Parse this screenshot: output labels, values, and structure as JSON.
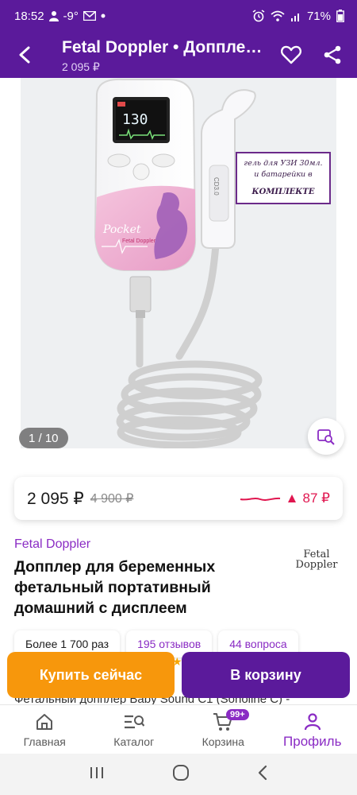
{
  "status_bar": {
    "time": "18:52",
    "temperature": "-9°",
    "battery": "71%"
  },
  "header": {
    "title": "Fetal Doppler • Допплер для беременных фетальный",
    "price": "2 095 ₽"
  },
  "gallery": {
    "counter": "1 / 10",
    "device_screen_value": "130",
    "device_brand": "Pocket",
    "device_subbrand": "Fetal Doppler",
    "probe_label": "CD3.0",
    "sticker_lines": [
      "гель для УЗИ 30мл.",
      "и батарейки в",
      "КОМПЛЕКТЕ"
    ]
  },
  "price": {
    "current": "2 095 ₽",
    "old": "4 900 ₽",
    "trend_change": "87 ₽"
  },
  "product": {
    "brand": "Fetal Doppler",
    "title": "Допплер для беременных фетальный портативный домашний с дисплеем",
    "logo_line1": "Fetal",
    "logo_line2": "Doppler",
    "description_preview": "Фетальный допплер Baby Sound C1 (Sonoline C) - "
  },
  "chips": {
    "sold": "Более 1 700 раз",
    "reviews": "195 отзывов",
    "questions": "44 вопроса"
  },
  "actions": {
    "buy_now": "Купить сейчас",
    "add_to_cart": "В корзину"
  },
  "bottom_nav": {
    "home": "Главная",
    "catalog": "Каталог",
    "cart": "Корзина",
    "cart_badge": "99+",
    "profile": "Профиль"
  },
  "colors": {
    "brand_purple": "#5b1a9b",
    "accent_purple": "#8a2bc4",
    "orange": "#f7970c",
    "price_up_red": "#e0164f"
  }
}
